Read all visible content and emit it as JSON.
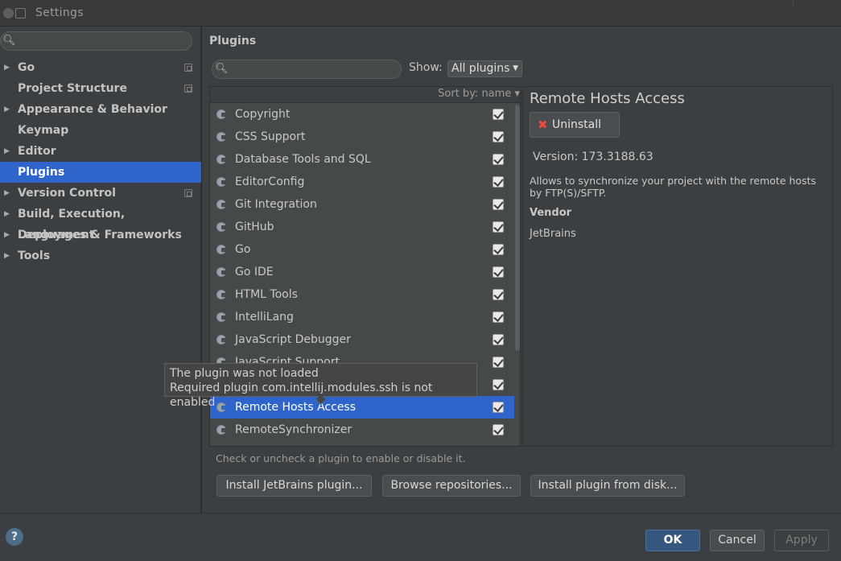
{
  "window": {
    "title": "Settings"
  },
  "sidebar": {
    "items": [
      {
        "label": "Go",
        "expandable": true,
        "project_level": true
      },
      {
        "label": "Project Structure",
        "expandable": false,
        "project_level": true
      },
      {
        "label": "Appearance & Behavior",
        "expandable": true,
        "project_level": false
      },
      {
        "label": "Keymap",
        "expandable": false,
        "project_level": false
      },
      {
        "label": "Editor",
        "expandable": true,
        "project_level": false
      },
      {
        "label": "Plugins",
        "expandable": false,
        "project_level": false,
        "selected": true
      },
      {
        "label": "Version Control",
        "expandable": true,
        "project_level": true
      },
      {
        "label": "Build, Execution, Deployment",
        "expandable": true,
        "project_level": false
      },
      {
        "label": "Languages & Frameworks",
        "expandable": true,
        "project_level": false
      },
      {
        "label": "Tools",
        "expandable": true,
        "project_level": false
      }
    ]
  },
  "plugins": {
    "title": "Plugins",
    "show_label": "Show:",
    "show_value": "All plugins",
    "sort_label": "Sort by: name",
    "list": [
      {
        "name": "Copyright",
        "enabled": true
      },
      {
        "name": "CSS Support",
        "enabled": true
      },
      {
        "name": "Database Tools and SQL",
        "enabled": true
      },
      {
        "name": "EditorConfig",
        "enabled": true
      },
      {
        "name": "Git Integration",
        "enabled": true
      },
      {
        "name": "GitHub",
        "enabled": true
      },
      {
        "name": "Go",
        "enabled": true
      },
      {
        "name": "Go IDE",
        "enabled": true
      },
      {
        "name": "HTML Tools",
        "enabled": true
      },
      {
        "name": "IntelliLang",
        "enabled": true
      },
      {
        "name": "JavaScript Debugger",
        "enabled": true
      },
      {
        "name": "JavaScript Support",
        "enabled": true
      },
      {
        "name": "",
        "enabled": true
      },
      {
        "name": "Remote Hosts Access",
        "enabled": true,
        "selected": true
      },
      {
        "name": "RemoteSynchronizer",
        "enabled": true
      },
      {
        "name": "",
        "enabled": true
      }
    ],
    "tooltip": {
      "line1": "The plugin was not loaded",
      "line2": "Required plugin com.intellij.modules.ssh is not enabled"
    },
    "hint": "Check or uncheck a plugin to enable or disable it.",
    "buttons": {
      "install_jetbrains": "Install JetBrains plugin...",
      "browse": "Browse repositories...",
      "install_disk": "Install plugin from disk..."
    }
  },
  "detail": {
    "title": "Remote Hosts Access",
    "uninstall": "Uninstall",
    "version": "Version: 173.3188.63",
    "description": "Allows to synchronize your project with the remote hosts by FTP(S)/SFTP.",
    "vendor_heading": "Vendor",
    "vendor": "JetBrains"
  },
  "footer": {
    "help": "?",
    "ok": "OK",
    "cancel": "Cancel",
    "apply": "Apply"
  }
}
